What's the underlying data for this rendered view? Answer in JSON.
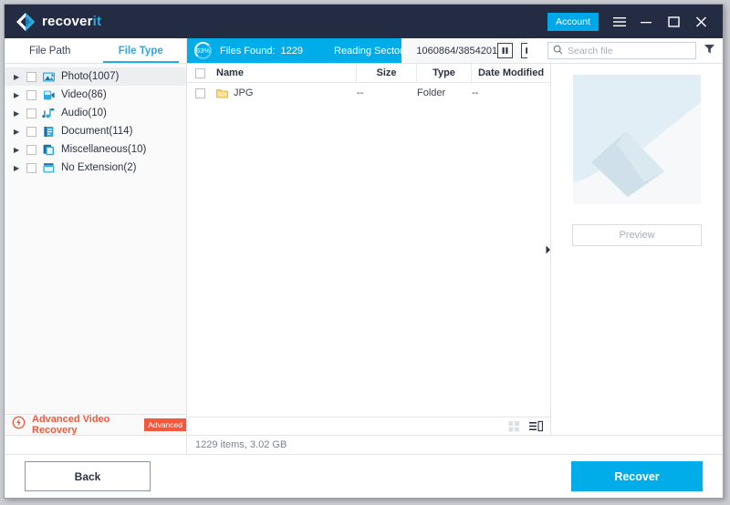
{
  "app": {
    "brand_primary": "recover",
    "brand_accent": "it",
    "titlebar_color": "#242c44",
    "accent_color": "#00ade8"
  },
  "titlebar": {
    "account_label": "Account",
    "menu_icon": "hamburger-menu-icon",
    "minimize_icon": "minimize-icon",
    "maximize_icon": "maximize-icon",
    "close_icon": "close-icon"
  },
  "tabs": [
    {
      "label": "File Path",
      "active": false
    },
    {
      "label": "File Type",
      "active": true
    }
  ],
  "scan": {
    "percent_label": "63%",
    "percent_value": 63,
    "files_found_label": "Files Found:",
    "files_found_value": "1229",
    "sectors_label": "Reading Sectors:",
    "sectors_value": "1060864/3854201",
    "pause_icon": "pause-icon",
    "stop_icon": "stop-icon"
  },
  "search": {
    "placeholder": "Search file",
    "value": "",
    "search_icon": "search-icon",
    "filter_icon": "filter-funnel-icon"
  },
  "sidebar": {
    "items": [
      {
        "label": "Photo(1007)",
        "icon": "photo-icon",
        "selected": true
      },
      {
        "label": "Video(86)",
        "icon": "video-icon",
        "selected": false
      },
      {
        "label": "Audio(10)",
        "icon": "audio-icon",
        "selected": false
      },
      {
        "label": "Document(114)",
        "icon": "document-icon",
        "selected": false
      },
      {
        "label": "Miscellaneous(10)",
        "icon": "miscellaneous-icon",
        "selected": false
      },
      {
        "label": "No Extension(2)",
        "icon": "no-extension-icon",
        "selected": false
      }
    ],
    "advanced": {
      "label": "Advanced Video Recovery",
      "badge": "Advanced",
      "icon": "advanced-recovery-bolt-icon",
      "color": "#f4573b"
    }
  },
  "filelist": {
    "columns": [
      "Name",
      "Size",
      "Type",
      "Date Modified"
    ],
    "rows": [
      {
        "name": "JPG",
        "size": "--",
        "type": "Folder",
        "date": "--",
        "icon": "folder-icon"
      }
    ],
    "grid_view_icon": "grid-view-icon",
    "list_view_icon": "list-view-icon",
    "collapse_icon": "collapse-panel-arrow-icon"
  },
  "preview": {
    "placeholder_icon": "image-placeholder-icon",
    "button_label": "Preview"
  },
  "status": {
    "text": "1229 items, 3.02  GB"
  },
  "footer": {
    "back_label": "Back",
    "recover_label": "Recover"
  }
}
